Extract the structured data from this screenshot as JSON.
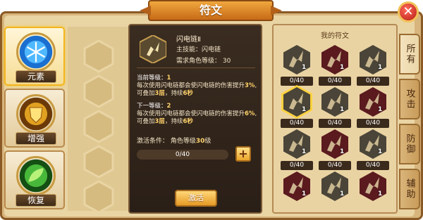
{
  "window": {
    "title": "符文",
    "close_symbol": "✕"
  },
  "categories": [
    {
      "label": "元素",
      "icon": "snowflake-icon",
      "active": true
    },
    {
      "label": "增强",
      "icon": "golden-shield-icon",
      "active": false
    },
    {
      "label": "恢复",
      "icon": "green-leaf-icon",
      "active": false
    }
  ],
  "detail": {
    "icon": "lightning-dragon-icon",
    "name": "闪电链Ⅱ",
    "main_skill": "主技能：闪电链",
    "required_level": "需求角色等级： 30",
    "current_level_label": "当前等级：",
    "current_level": "1",
    "current_desc_pre": "每次使用闪电链都会使闪电链的伤害提升",
    "current_pct": "3%",
    "current_desc_mid": ",可叠加",
    "current_stack": "3层",
    "current_desc_dur": "，持续",
    "current_time": "6秒",
    "next_level_label": "下一等级：",
    "next_level": "2",
    "next_desc_pre": "每次使用闪电链都会使闪电链的伤害提升",
    "next_pct": "6%",
    "next_desc_mid": ",可叠加",
    "next_stack": "3层",
    "next_desc_dur": "，持续",
    "next_time": "6秒",
    "activate_condition_pre": "激活条件： 角色等级",
    "activate_condition_level": "30",
    "activate_condition_post": "级",
    "progress_text": "0/40",
    "progress_value": 0,
    "plus_symbol": "+",
    "activate_button": "激活"
  },
  "my_runes": {
    "title": "我的符文",
    "items": [
      {
        "count": "1",
        "level": "0/40",
        "color": "#4a4538",
        "selected": false
      },
      {
        "count": "1",
        "level": "0/40",
        "color": "#5a1a1e",
        "selected": false
      },
      {
        "count": "1",
        "level": "0/40",
        "color": "#4a4538",
        "selected": false
      },
      {
        "count": "1",
        "level": "0/40",
        "color": "#4a4538",
        "selected": true
      },
      {
        "count": "1",
        "level": "0/40",
        "color": "#4a4538",
        "selected": false
      },
      {
        "count": "1",
        "level": "0/40",
        "color": "#5a1a1e",
        "selected": false
      },
      {
        "count": "1",
        "level": "0/40",
        "color": "#4a4538",
        "selected": false
      },
      {
        "count": "1",
        "level": "0/40",
        "color": "#5a1a1e",
        "selected": false
      },
      {
        "count": "1",
        "level": "0/40",
        "color": "#4a4538",
        "selected": false
      },
      {
        "count": "1",
        "level": "",
        "color": "#5a1a1e",
        "selected": false
      },
      {
        "count": "1",
        "level": "",
        "color": "#4a4538",
        "selected": false
      },
      {
        "count": "1",
        "level": "",
        "color": "#5a1a1e",
        "selected": false
      }
    ]
  },
  "tabs": [
    {
      "label": "所有",
      "active": true
    },
    {
      "label": "攻击",
      "active": false
    },
    {
      "label": "防御",
      "active": false
    },
    {
      "label": "辅助",
      "active": false
    }
  ]
}
